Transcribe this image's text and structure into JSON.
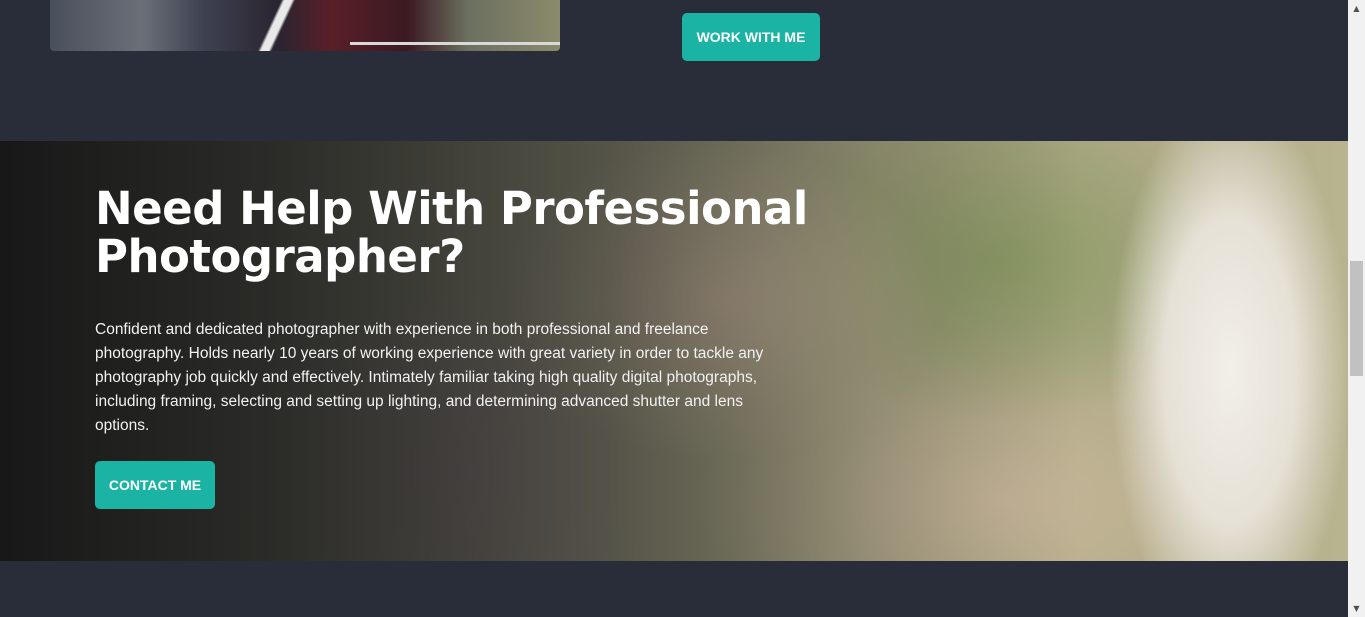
{
  "top_section": {
    "work_button_label": "WORK WITH ME"
  },
  "hero": {
    "title": "Need Help With Professional Photographer?",
    "description": "Confident and dedicated photographer with experience in both professional and freelance photography. Holds nearly 10 years of working experience with great variety in order to tackle any photography job quickly and effectively. Intimately familiar taking high quality digital photographs, including framing, selecting and setting up lighting, and determining advanced shutter and lens options.",
    "contact_button_label": "CONTACT ME"
  },
  "colors": {
    "background": "#292d3a",
    "accent": "#1bb4a4",
    "text": "#ffffff"
  },
  "scrollbar": {
    "up_icon": "chevron-up-icon",
    "down_icon": "chevron-down-icon"
  }
}
